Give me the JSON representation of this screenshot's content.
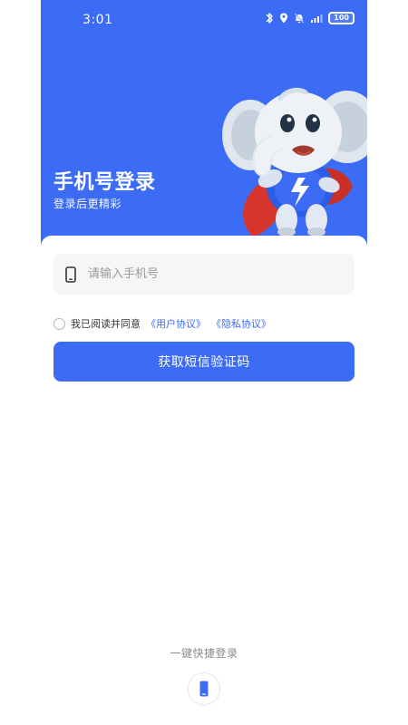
{
  "status_bar": {
    "time": "3:01",
    "battery_text": "100"
  },
  "header": {
    "title": "手机号登录",
    "subtitle": "登录后更精彩"
  },
  "login_form": {
    "phone_placeholder": "请输入手机号",
    "agreement_prefix": "我已阅读并同意",
    "user_agreement_link": "《用户协议》",
    "privacy_policy_link": "《隐私协议》",
    "sms_button_label": "获取短信验证码"
  },
  "quick_login": {
    "label": "一键快捷登录",
    "icon": "phone-icon"
  },
  "colors": {
    "brand_blue": "#3c6cf6",
    "text_gray": "#8a8a8a",
    "field_bg": "#f5f6f7"
  },
  "icons": {
    "status": [
      "bluetooth-icon",
      "location-icon",
      "mute-icon",
      "signal-icon",
      "battery-icon"
    ],
    "field": "phone-icon",
    "mascot": "elephant-mascot"
  }
}
